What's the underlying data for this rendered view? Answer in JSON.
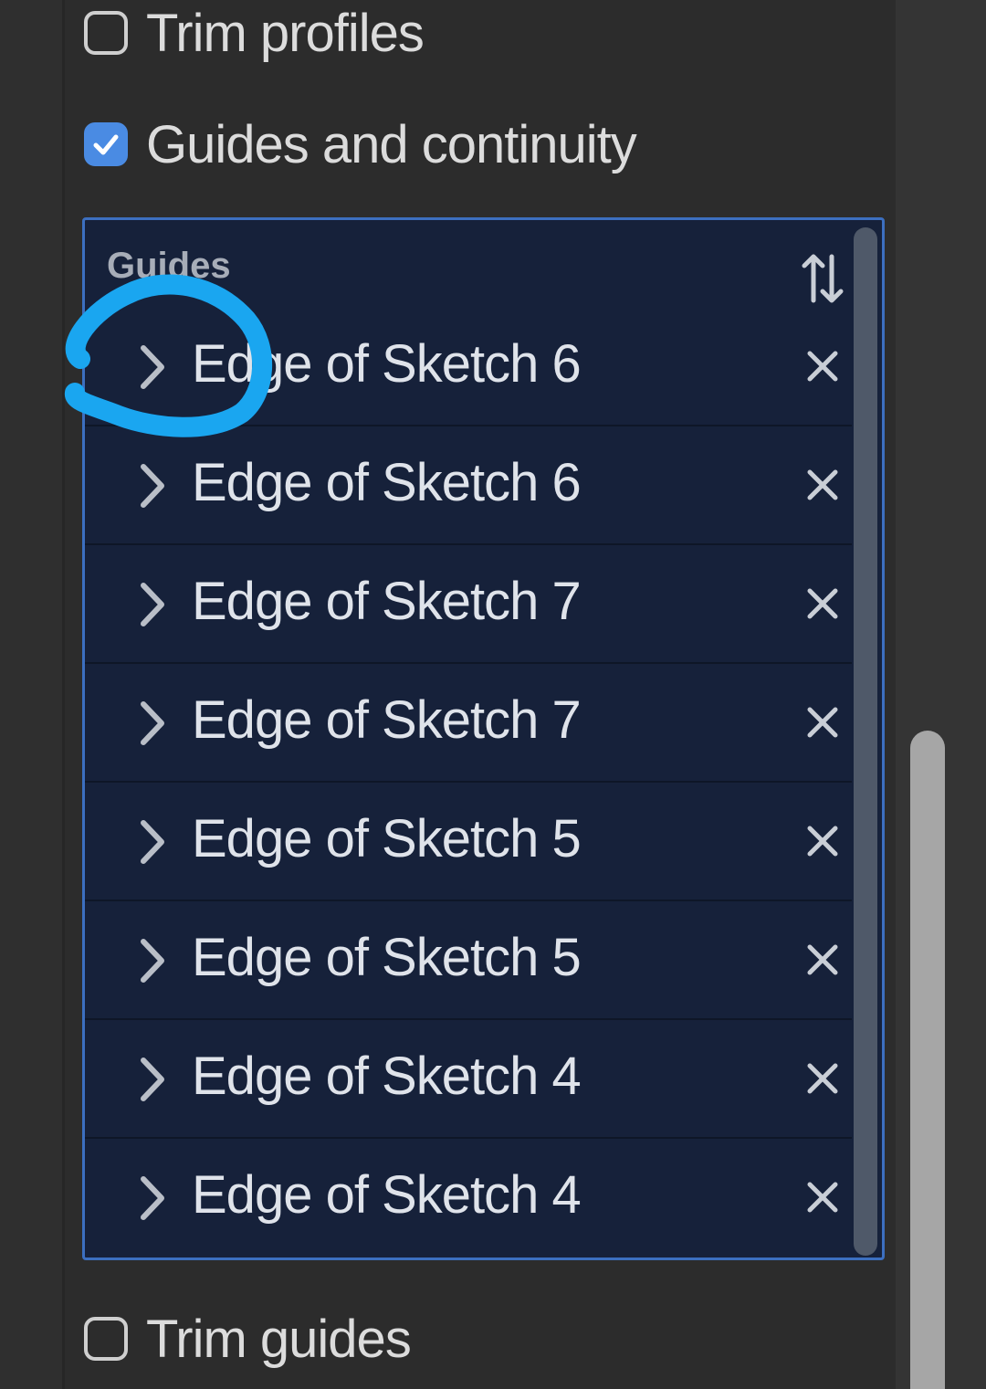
{
  "trim_profiles": {
    "label": "Trim profiles",
    "checked": false
  },
  "guides_and_continuity": {
    "label": "Guides and continuity",
    "checked": true
  },
  "guides": {
    "title": "Guides",
    "items": [
      {
        "label": "Edge of Sketch 6"
      },
      {
        "label": "Edge of Sketch 6"
      },
      {
        "label": "Edge of Sketch 7"
      },
      {
        "label": "Edge of Sketch 7"
      },
      {
        "label": "Edge of Sketch 5"
      },
      {
        "label": "Edge of Sketch 5"
      },
      {
        "label": "Edge of Sketch 4"
      },
      {
        "label": "Edge of Sketch 4"
      }
    ]
  },
  "trim_guides": {
    "label": "Trim guides",
    "checked": false
  },
  "colors": {
    "accent": "#4a8be3",
    "list_background": "#16213a",
    "panel_background": "#2c2c2c",
    "annotation": "#1aa6f0"
  },
  "icons": {
    "sort": "sort-up-down-icon",
    "expand": "chevron-right-icon",
    "remove": "close-icon",
    "check": "checkmark-icon"
  }
}
